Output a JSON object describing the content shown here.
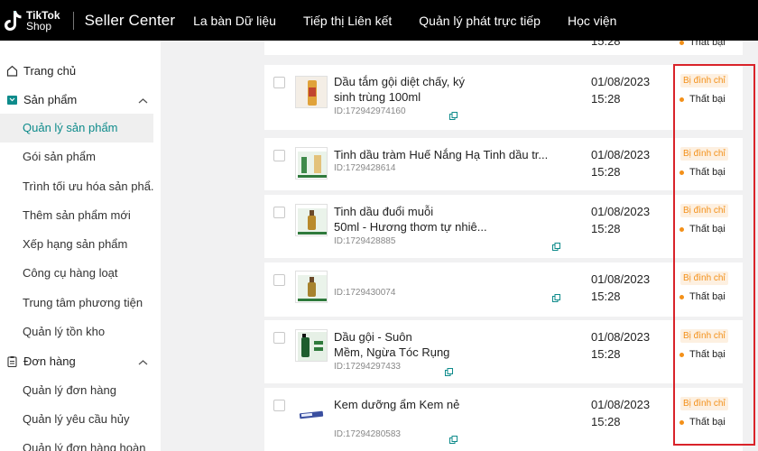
{
  "header": {
    "logo_line1": "TikTok",
    "logo_line2": "Shop",
    "brand": "Seller Center",
    "nav": [
      "La bàn Dữ liệu",
      "Tiếp thị Liên kết",
      "Quản lý phát trực tiếp",
      "Học viện"
    ]
  },
  "sidebar": {
    "home": "Trang chủ",
    "products": "Sản phẩm",
    "product_items": [
      "Quản lý sản phẩm",
      "Gói sản phẩm",
      "Trình tối ưu hóa sản phẩ...",
      "Thêm sản phẩm mới",
      "Xếp hạng sản phẩm",
      "Công cụ hàng loạt",
      "Trung tâm phương tiện",
      "Quản lý tồn kho"
    ],
    "orders": "Đơn hàng",
    "order_items": [
      "Quản lý đơn hàng",
      "Quản lý yêu cầu hủy",
      "Quản lý đơn hàng hoàn"
    ]
  },
  "top_partial": {
    "time": "15:28",
    "status": "Thất bại"
  },
  "products": [
    {
      "name_line1": "Dầu tắm gội diệt chấy, ký",
      "name_line2": "sinh trùng              100ml",
      "id": "ID:172942974160",
      "date": "01/08/2023",
      "time": "15:28",
      "badge": "Bị đình chỉ",
      "status": "Thất bại"
    },
    {
      "name_line1": "Tinh dầu tràm Huế Nắng Hạ              Tinh dầu tr...",
      "name_line2": "",
      "id": "ID:1729428614",
      "date": "01/08/2023",
      "time": "15:28",
      "badge": "Bị đình chỉ",
      "status": "Thất bại"
    },
    {
      "name_line1": "Tinh dầu đuổi muỗi",
      "name_line2": "50ml - Hương thơm tự nhiê...",
      "id": "ID:1729428885",
      "date": "01/08/2023",
      "time": "15:28",
      "badge": "Bị đình chỉ",
      "status": "Thất bại"
    },
    {
      "name_line1": "",
      "name_line2": "",
      "id": "ID:1729430074",
      "date": "01/08/2023",
      "time": "15:28",
      "badge": "Bị đình chỉ",
      "status": "Thất bại"
    },
    {
      "name_line1": "Dầu gội                         - Suôn",
      "name_line2": "Mềm, Ngừa Tóc Rụng",
      "id": "ID:17294297433",
      "date": "01/08/2023",
      "time": "15:28",
      "badge": "Bị đình chỉ",
      "status": "Thất bại"
    },
    {
      "name_line1": "Kem dưỡng ẩm Kem nẻ",
      "name_line2": "",
      "id": "ID:17294280583",
      "date": "01/08/2023",
      "time": "15:28",
      "badge": "Bị đình chỉ",
      "status": "Thất bại"
    }
  ],
  "colors": {
    "accent": "#0e8b8b",
    "badge_text": "#f39019",
    "highlight_border": "#d9232a"
  }
}
